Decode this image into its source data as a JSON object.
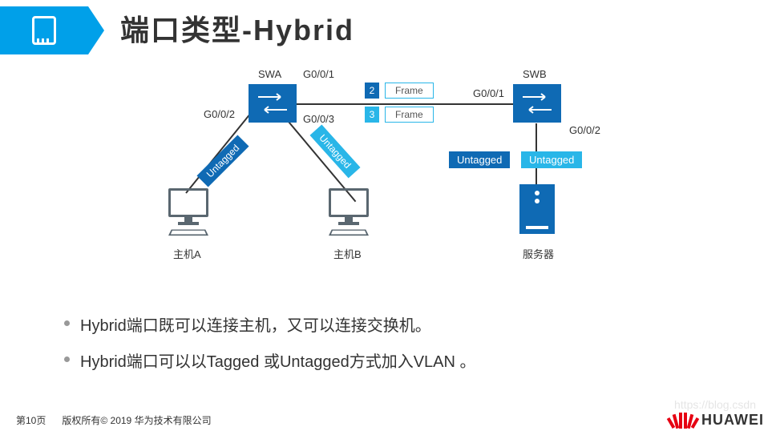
{
  "title": "端口类型-Hybrid",
  "diagram": {
    "switches": {
      "a": "SWA",
      "b": "SWB"
    },
    "ports": {
      "swa_right": "G0/0/1",
      "swa_left": "G0/0/2",
      "swa_bottom": "G0/0/3",
      "swb_left": "G0/0/1",
      "swb_bottom": "G0/0/2"
    },
    "frames": {
      "num1": "2",
      "label1": "Frame",
      "num2": "3",
      "label2": "Frame"
    },
    "tags": {
      "left": "Untagged",
      "right": "Untagged",
      "server_left": "Untagged",
      "server_right": "Untagged"
    },
    "hosts": {
      "a": "主机A",
      "b": "主机B",
      "server": "服务器"
    }
  },
  "bullets": [
    "Hybrid端口既可以连接主机，又可以连接交换机。",
    "Hybrid端口可以以Tagged 或Untagged方式加入VLAN 。"
  ],
  "footer": {
    "page": "第10页",
    "copyright": "版权所有© 2019 华为技术有限公司"
  },
  "logo": "HUAWEI",
  "watermark": "https://blog.csdn"
}
